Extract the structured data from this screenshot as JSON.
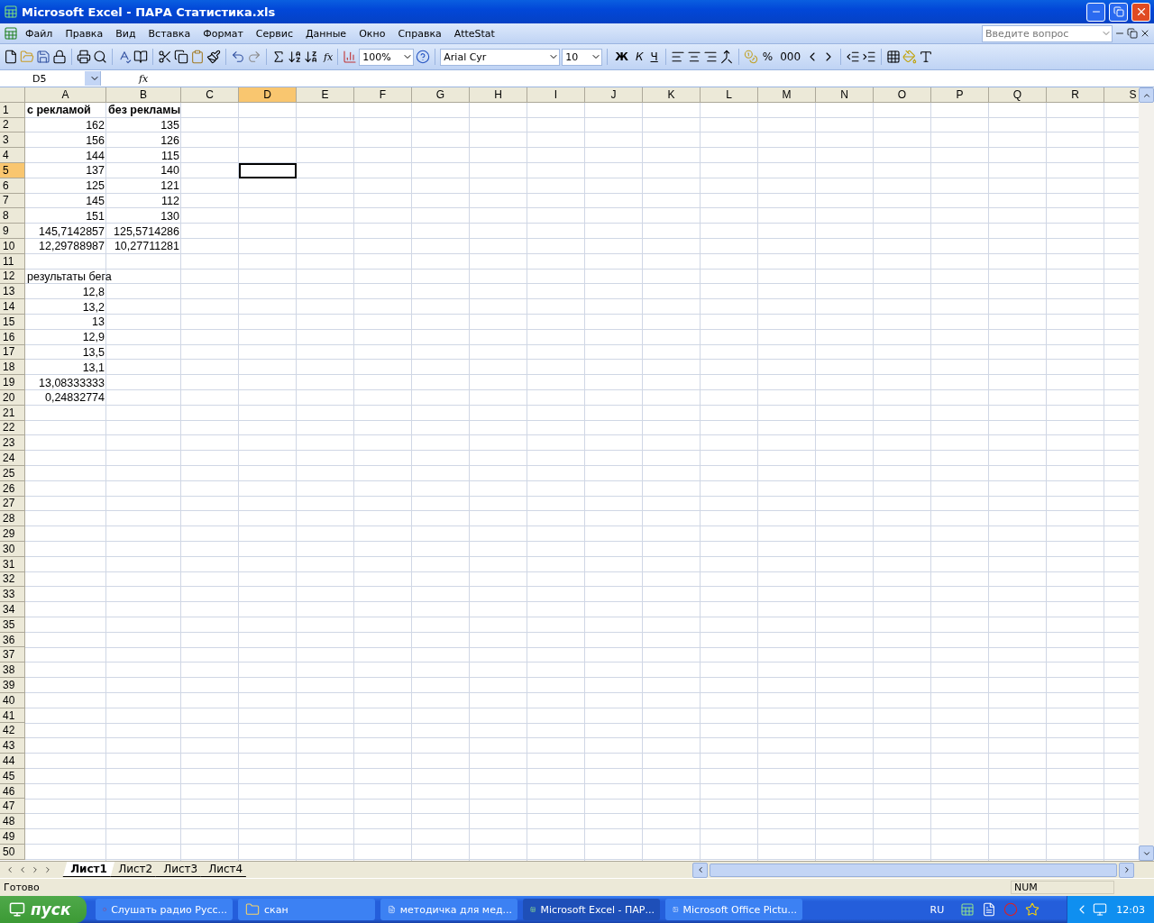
{
  "window": {
    "title": "Microsoft Excel - ПАРА Статистика.xls"
  },
  "menu": {
    "items": [
      "Файл",
      "Правка",
      "Вид",
      "Вставка",
      "Формат",
      "Сервис",
      "Данные",
      "Окно",
      "Справка",
      "AtteStat"
    ],
    "help_placeholder": "Введите вопрос"
  },
  "toolbar": {
    "fx_button": "fx",
    "zoom": "100%",
    "font": "Arial Cyr",
    "size": "10",
    "format_buttons": [
      "Ж",
      "К",
      "Ч"
    ],
    "number_buttons": [
      "%",
      "000"
    ]
  },
  "formula_bar": {
    "name_box": "D5",
    "fx": "fx"
  },
  "columns": [
    {
      "label": "A",
      "selected": false
    },
    {
      "label": "B",
      "selected": false
    },
    {
      "label": "C",
      "selected": false
    },
    {
      "label": "D",
      "selected": true
    },
    {
      "label": "E",
      "selected": false
    },
    {
      "label": "F",
      "selected": false
    },
    {
      "label": "G",
      "selected": false
    },
    {
      "label": "H",
      "selected": false
    },
    {
      "label": "I",
      "selected": false
    },
    {
      "label": "J",
      "selected": false
    },
    {
      "label": "K",
      "selected": false
    },
    {
      "label": "L",
      "selected": false
    },
    {
      "label": "M",
      "selected": false
    },
    {
      "label": "N",
      "selected": false
    },
    {
      "label": "O",
      "selected": false
    },
    {
      "label": "P",
      "selected": false
    },
    {
      "label": "Q",
      "selected": false
    },
    {
      "label": "R",
      "selected": false
    },
    {
      "label": "S",
      "selected": false
    }
  ],
  "rows": [
    {
      "label": "1",
      "selected": false,
      "cells": [
        {
          "text": "с рекламой",
          "kind": "header"
        },
        {
          "text": "без рекламы",
          "kind": "header"
        }
      ]
    },
    {
      "label": "2",
      "selected": false,
      "cells": [
        {
          "text": "162",
          "kind": "number"
        },
        {
          "text": "135",
          "kind": "number"
        }
      ]
    },
    {
      "label": "3",
      "selected": false,
      "cells": [
        {
          "text": "156",
          "kind": "number"
        },
        {
          "text": "126",
          "kind": "number"
        }
      ]
    },
    {
      "label": "4",
      "selected": false,
      "cells": [
        {
          "text": "144",
          "kind": "number"
        },
        {
          "text": "115",
          "kind": "number"
        }
      ]
    },
    {
      "label": "5",
      "selected": true,
      "cells": [
        {
          "text": "137",
          "kind": "number"
        },
        {
          "text": "140",
          "kind": "number"
        }
      ]
    },
    {
      "label": "6",
      "selected": false,
      "cells": [
        {
          "text": "125",
          "kind": "number"
        },
        {
          "text": "121",
          "kind": "number"
        }
      ]
    },
    {
      "label": "7",
      "selected": false,
      "cells": [
        {
          "text": "145",
          "kind": "number"
        },
        {
          "text": "112",
          "kind": "number"
        }
      ]
    },
    {
      "label": "8",
      "selected": false,
      "cells": [
        {
          "text": "151",
          "kind": "number"
        },
        {
          "text": "130",
          "kind": "number"
        }
      ]
    },
    {
      "label": "9",
      "selected": false,
      "cells": [
        {
          "text": "145,7142857",
          "kind": "number"
        },
        {
          "text": "125,5714286",
          "kind": "number"
        }
      ]
    },
    {
      "label": "10",
      "selected": false,
      "cells": [
        {
          "text": "12,29788987",
          "kind": "number"
        },
        {
          "text": "10,27711281",
          "kind": "number"
        }
      ]
    },
    {
      "label": "11",
      "selected": false
    },
    {
      "label": "12",
      "selected": false,
      "cells": [
        {
          "text": "результаты бега",
          "kind": "text"
        }
      ]
    },
    {
      "label": "13",
      "selected": false,
      "cells": [
        {
          "text": "12,8",
          "kind": "number"
        }
      ]
    },
    {
      "label": "14",
      "selected": false,
      "cells": [
        {
          "text": "13,2",
          "kind": "number"
        }
      ]
    },
    {
      "label": "15",
      "selected": false,
      "cells": [
        {
          "text": "13",
          "kind": "number"
        }
      ]
    },
    {
      "label": "16",
      "selected": false,
      "cells": [
        {
          "text": "12,9",
          "kind": "number"
        }
      ]
    },
    {
      "label": "17",
      "selected": false,
      "cells": [
        {
          "text": "13,5",
          "kind": "number"
        }
      ]
    },
    {
      "label": "18",
      "selected": false,
      "cells": [
        {
          "text": "13,1",
          "kind": "number"
        }
      ]
    },
    {
      "label": "19",
      "selected": false,
      "cells": [
        {
          "text": "13,08333333",
          "kind": "number"
        }
      ]
    },
    {
      "label": "20",
      "selected": false,
      "cells": [
        {
          "text": "0,24832774",
          "kind": "number"
        }
      ]
    },
    {
      "label": "21",
      "selected": false
    },
    {
      "label": "22",
      "selected": false
    },
    {
      "label": "23",
      "selected": false
    },
    {
      "label": "24",
      "selected": false
    },
    {
      "label": "25",
      "selected": false
    },
    {
      "label": "26",
      "selected": false
    },
    {
      "label": "27",
      "selected": false
    },
    {
      "label": "28",
      "selected": false
    },
    {
      "label": "29",
      "selected": false
    },
    {
      "label": "30",
      "selected": false
    },
    {
      "label": "31",
      "selected": false
    },
    {
      "label": "32",
      "selected": false
    },
    {
      "label": "33",
      "selected": false
    },
    {
      "label": "34",
      "selected": false
    },
    {
      "label": "35",
      "selected": false
    },
    {
      "label": "36",
      "selected": false
    },
    {
      "label": "37",
      "selected": false
    },
    {
      "label": "38",
      "selected": false
    },
    {
      "label": "39",
      "selected": false
    },
    {
      "label": "40",
      "selected": false
    },
    {
      "label": "41",
      "selected": false
    },
    {
      "label": "42",
      "selected": false
    },
    {
      "label": "43",
      "selected": false
    },
    {
      "label": "44",
      "selected": false
    },
    {
      "label": "45",
      "selected": false
    },
    {
      "label": "46",
      "selected": false
    },
    {
      "label": "47",
      "selected": false
    },
    {
      "label": "48",
      "selected": false
    },
    {
      "label": "49",
      "selected": false
    },
    {
      "label": "50",
      "selected": false
    }
  ],
  "sheet_tabs": [
    {
      "label": "Лист1",
      "selected": true
    },
    {
      "label": "Лист2",
      "selected": false
    },
    {
      "label": "Лист3",
      "selected": false
    },
    {
      "label": "Лист4",
      "selected": false
    }
  ],
  "status_bar": {
    "text": "Готово",
    "indicator": "NUM"
  },
  "taskbar": {
    "start": "пуск",
    "tasks": [
      {
        "label": "Слушать радио Русс...",
        "selected": false,
        "kind": "browser"
      },
      {
        "label": "скан",
        "selected": false,
        "kind": "folder"
      },
      {
        "label": "методичка для мед...",
        "selected": false,
        "kind": "word"
      },
      {
        "label": "Microsoft Excel - ПАР...",
        "selected": true,
        "kind": "excel"
      },
      {
        "label": "Microsoft Office Pictu...",
        "selected": false,
        "kind": "picture"
      }
    ],
    "language": "RU",
    "clock": "12:03"
  }
}
